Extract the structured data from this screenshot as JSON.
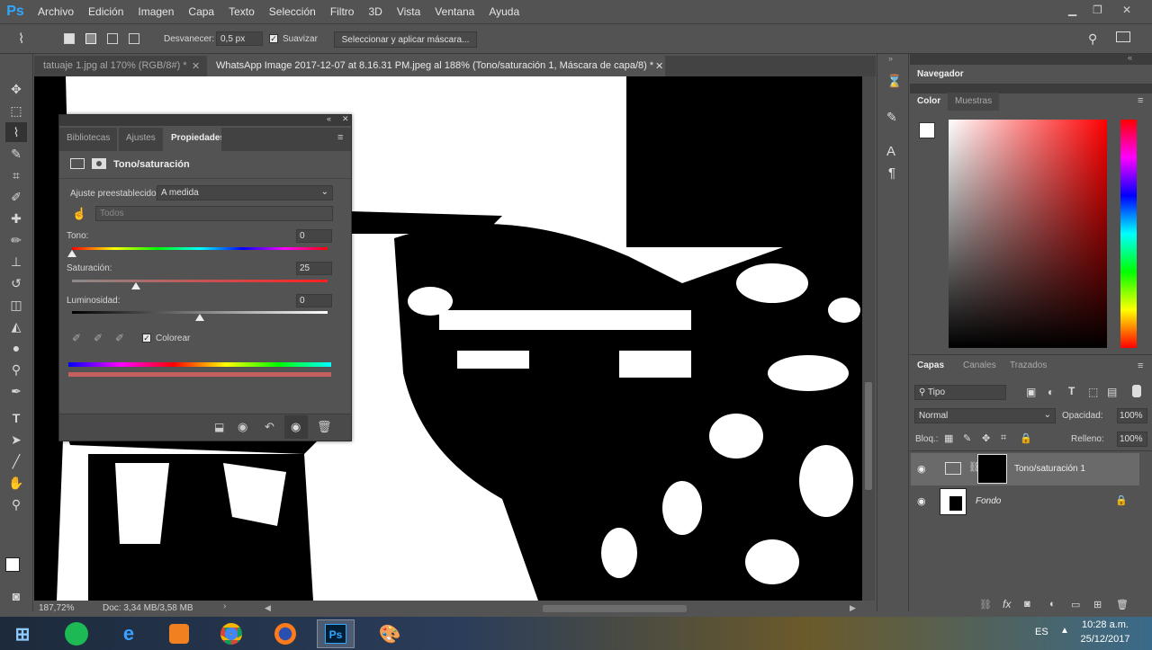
{
  "app": {
    "name": "Ps"
  },
  "menu": [
    "Archivo",
    "Edición",
    "Imagen",
    "Capa",
    "Texto",
    "Selección",
    "Filtro",
    "3D",
    "Vista",
    "Ventana",
    "Ayuda"
  ],
  "options": {
    "feather_label": "Desvanecer:",
    "feather_value": "0,5 px",
    "smooth_label": "Suavizar",
    "select_mask_button": "Seleccionar y aplicar máscara..."
  },
  "tabs": [
    {
      "label": "tatuaje 1.jpg al 170% (RGB/8#) *",
      "active": false
    },
    {
      "label": "WhatsApp Image 2017-12-07 at 8.16.31 PM.jpeg al 188% (Tono/saturación 1, Máscara de capa/8) *",
      "active": true
    }
  ],
  "properties": {
    "tabs": [
      "Bibliotecas",
      "Ajustes",
      "Propiedades"
    ],
    "title": "Tono/saturación",
    "preset_label": "Ajuste preestablecido:",
    "preset_value": "A medida",
    "range_value": "Todos",
    "hue_label": "Tono:",
    "hue_value": "0",
    "hue_pos": 0,
    "saturation_label": "Saturación:",
    "saturation_value": "25",
    "saturation_pos": 0.25,
    "lightness_label": "Luminosidad:",
    "lightness_value": "0",
    "lightness_pos": 0.5,
    "colorize_label": "Colorear"
  },
  "status": {
    "zoom": "187,72%",
    "doc": "Doc: 3,34 MB/3,58 MB"
  },
  "right_panels": {
    "navigator_tab": "Navegador",
    "color_tab": "Color",
    "swatches_tab": "Muestras",
    "layers_tabs": [
      "Capas",
      "Canales",
      "Trazados"
    ],
    "filter_label": "Tipo",
    "blend_mode": "Normal",
    "opacity_label": "Opacidad:",
    "opacity_value": "100%",
    "lock_label": "Bloq.:",
    "fill_label": "Relleno:",
    "fill_value": "100%"
  },
  "layers": [
    {
      "name": "Tono/saturación 1",
      "selected": true
    },
    {
      "name": "Fondo",
      "selected": false
    }
  ],
  "taskbar": {
    "language": "ES",
    "time": "10:28 a.m.",
    "date": "25/12/2017"
  },
  "colors": {
    "ps_blue": "#31a8ff",
    "panel": "#535353"
  }
}
